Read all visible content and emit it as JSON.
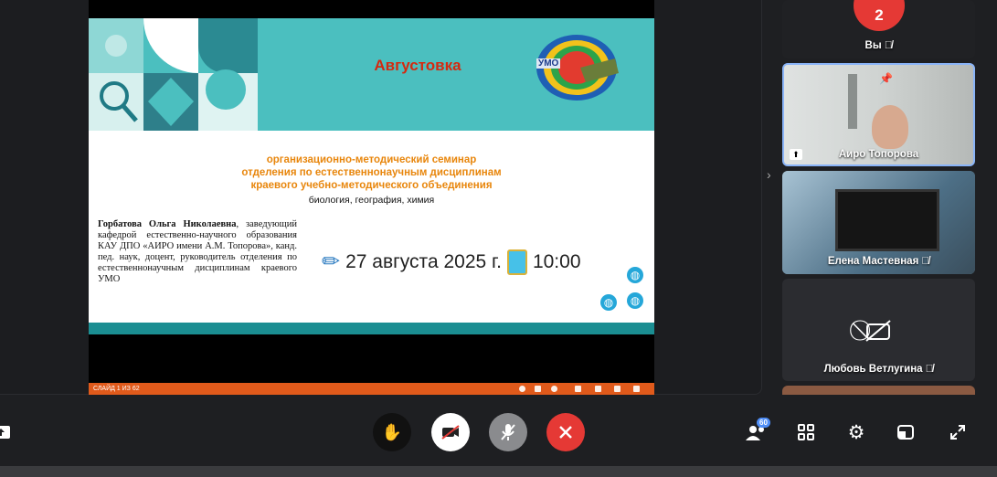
{
  "slide": {
    "title": "Августовка",
    "seminar_line1": "организационно-методический семинар",
    "seminar_line2": "отделения по естественнонаучным дисциплинам",
    "seminar_line3": "краевого учебно-методического объединения",
    "subjects": "биология, география, химия",
    "speaker_name": "Горбатова Ольга Николаевна",
    "speaker_desc": ", заведующий кафедрой естественно-научного образования КАУ ДПО «АИРО имени А.М. Топорова», канд. пед. наук, доцент, руководитель отделения по естественнонаучным дисциплинам краевого УМО",
    "date": "27 августа 2025 г.",
    "time": "10:00",
    "logo_text": "УМО",
    "status_text": "СЛАЙД 1 ИЗ 62"
  },
  "participants": [
    {
      "name": "Вы",
      "badge": "2",
      "muted": true
    },
    {
      "name": "Аиро Топорова",
      "pinned": true
    },
    {
      "name": "Елена Мастевная",
      "muted": true
    },
    {
      "name": "Любовь Ветлугина",
      "muted": true,
      "camera_off": true
    }
  ],
  "controls": {
    "participants_count": "60"
  },
  "colors": {
    "leave": "#e53935",
    "slide_banner": "#4bbfbf",
    "slide_status": "#e05a1b"
  }
}
